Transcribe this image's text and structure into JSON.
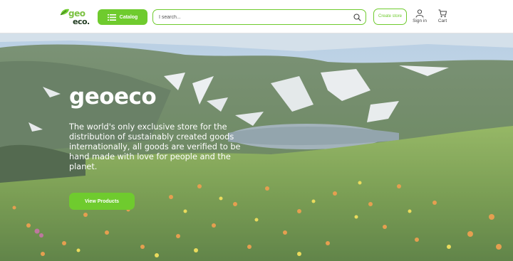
{
  "header": {
    "logo": {
      "line1": "geo",
      "line2": "eco."
    },
    "catalog_label": "Catalog",
    "search": {
      "placeholder": "I search..."
    },
    "create_store_label": "Create store",
    "signin_label": "Sign in",
    "cart_label": "Cart"
  },
  "hero": {
    "title": "geoeco",
    "description": "The world's only exclusive store for the distribution of sustainably created goods internationally, all goods are verified to be hand made with love for people and the planet.",
    "cta_label": "View Products"
  },
  "colors": {
    "accent": "#6fcb2e",
    "logo_dark": "#1f3a1f"
  },
  "icons": [
    "leaf-icon",
    "menu-icon",
    "search-icon",
    "user-icon",
    "cart-icon"
  ]
}
